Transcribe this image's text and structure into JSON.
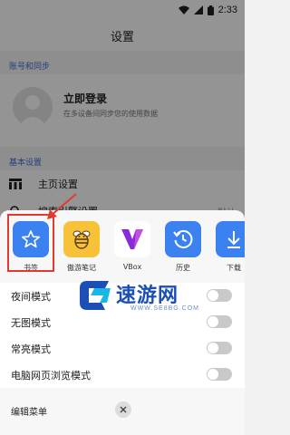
{
  "status": {
    "time": "2:33"
  },
  "page": {
    "title": "设置",
    "account_section": "账号和同步",
    "login_title": "立即登录",
    "login_subtitle": "在多设备间同步您的使用数据",
    "basic_section": "基本设置",
    "rows": [
      {
        "label": "主页设置",
        "value": "",
        "icon": "home-grid-icon"
      },
      {
        "label": "搜索引擎设置",
        "value": "默认",
        "icon": "search-icon"
      }
    ]
  },
  "sheet": {
    "apps": [
      {
        "label": "书签",
        "icon": "star-icon",
        "color": "#3b82f0"
      },
      {
        "label": "傲游笔记",
        "icon": "bee-icon",
        "color": "#f7c238"
      },
      {
        "label": "VBox",
        "icon": "vbox-icon",
        "color": "#ffffff"
      },
      {
        "label": "历史",
        "icon": "history-icon",
        "color": "#3b82f0"
      },
      {
        "label": "下载",
        "icon": "download-icon",
        "color": "#3b82f0"
      }
    ],
    "toggles": [
      {
        "label": "夜间模式",
        "on": false
      },
      {
        "label": "无图模式",
        "on": false
      },
      {
        "label": "常亮模式",
        "on": false
      },
      {
        "label": "电脑网页浏览模式",
        "on": false
      }
    ],
    "edit_menu": "编辑菜单"
  },
  "watermark": {
    "text": "速游网",
    "url": "WWW.SE8BG.COM"
  },
  "colors": {
    "accent_blue": "#3b82f0",
    "highlight_red": "#e13b2f",
    "section_blue": "#3b6fd8"
  }
}
